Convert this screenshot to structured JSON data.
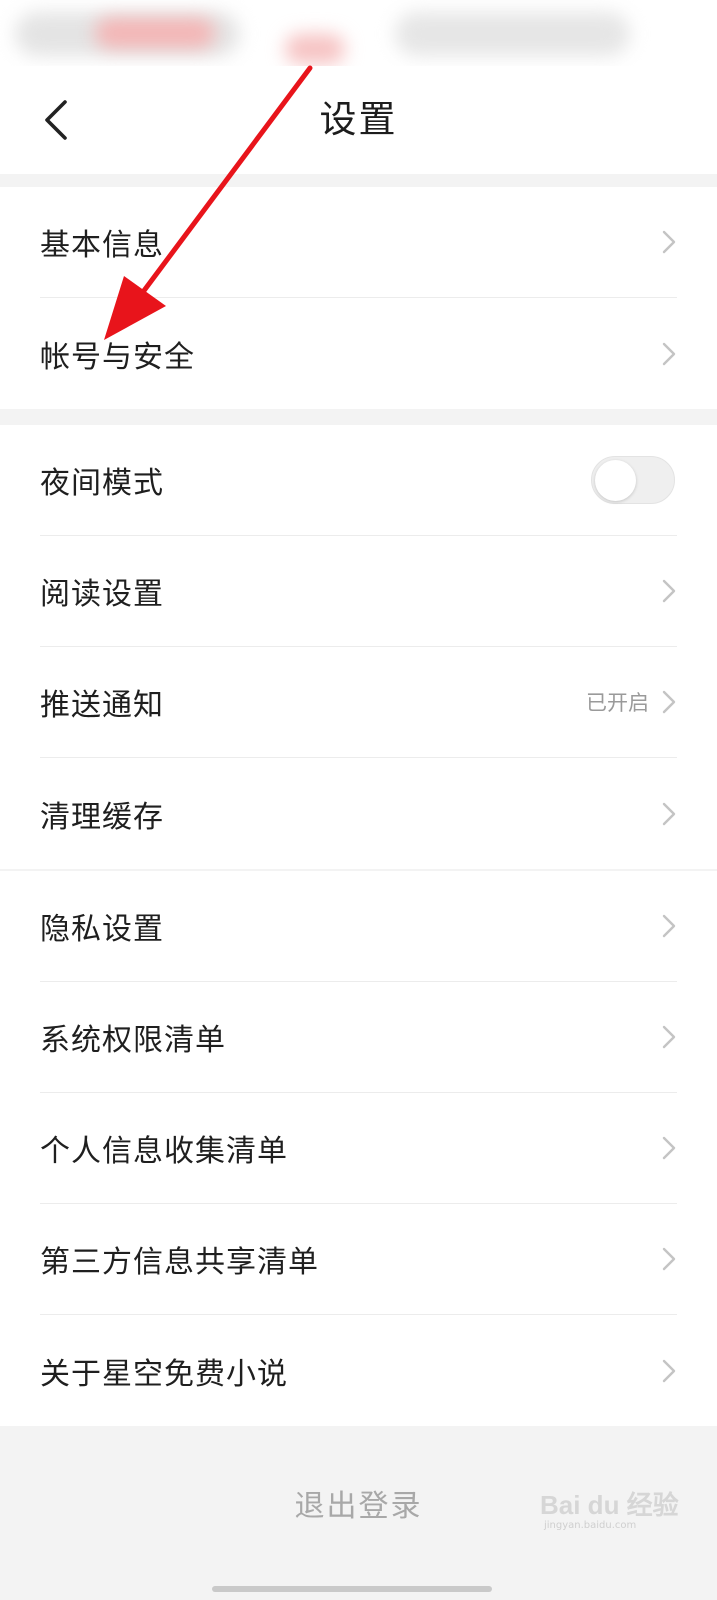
{
  "header": {
    "title": "设置"
  },
  "groups": [
    {
      "items": [
        {
          "label": "基本信息"
        },
        {
          "label": "帐号与安全"
        }
      ]
    },
    {
      "items": [
        {
          "label": "夜间模式",
          "toggle": false
        },
        {
          "label": "阅读设置"
        },
        {
          "label": "推送通知",
          "value": "已开启"
        },
        {
          "label": "清理缓存"
        }
      ]
    },
    {
      "items": [
        {
          "label": "隐私设置"
        },
        {
          "label": "系统权限清单"
        },
        {
          "label": "个人信息收集清单"
        },
        {
          "label": "第三方信息共享清单"
        },
        {
          "label": "关于星空免费小说"
        }
      ]
    }
  ],
  "footer": {
    "logout_label": "退出登录"
  },
  "watermark": {
    "main": "Bai du 经验",
    "sub": "jingyan.baidu.com"
  },
  "colors": {
    "annotation_arrow": "#e8141b",
    "background": "#f3f3f3",
    "row_bg": "#ffffff"
  },
  "icons": {
    "back": "chevron-left-icon",
    "row_chevron": "chevron-right-icon"
  }
}
